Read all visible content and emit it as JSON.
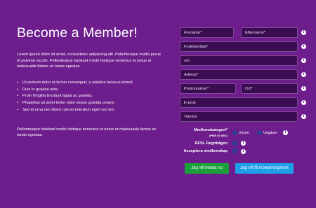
{
  "page": {
    "title": "Become a Member!",
    "intro": "Lorem ipsum dolor sit amet, consectetur adipiscing elit. Pellentesque mollis purus et pulvinar iaculis. Pellentesque habitant morbi tristique senectus et netus et malesuada fames ac turpis egestas.",
    "bullets": [
      "Ut pretium dolor ut lectus consequat, a sodales lacus euismod.",
      "Duis in gravida ante.",
      "Proin fringilla tincidunt ligula ac gravida.",
      "Phasellus sit amet tortor vitae neque gravida ornare.",
      "Sed id urna nec libero rutrum interdum eget non leo."
    ],
    "outro": "Pellentesque habitant morbi tristique senectus et netus et malesuada fames ac turpis egestas."
  },
  "form": {
    "firstname": "Förnamn*",
    "lastname": "Efternamn*",
    "birthdate": "Fodelsedata*",
    "co": "c/o",
    "address": "Adress*",
    "postcode": "Postnummer*",
    "city": "Ort*",
    "email": "E-post",
    "phone": "Telefon",
    "category_label": "Medlemskategori*",
    "category_sub": "(PRIS 50 SEK)",
    "option_adult": "Vuxen",
    "option_youth": "Ungdom",
    "rfsl_label": "RFSL Regnbågen",
    "accept_label": "Acceptera medlemskap",
    "pay_now_button": "Jag vill betala nu",
    "invoice_button": "Jag vill få inbetalningskort"
  },
  "colors": {
    "background": "#6e1d8c",
    "field_bg": "#3c0c52",
    "radio": "#333c96",
    "green": "#1aa03a",
    "blue": "#1ea0e8"
  },
  "icons": {
    "info": "info-icon"
  }
}
